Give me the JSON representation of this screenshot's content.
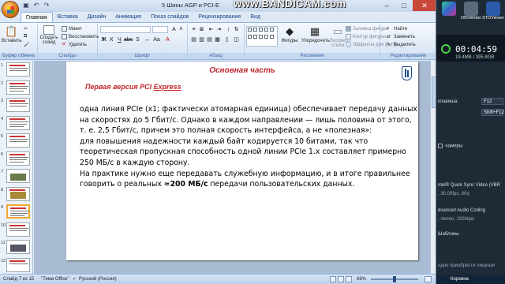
{
  "window": {
    "title": "5 Шины AGP и PCI-E",
    "watermark": "www.BANDICAM.com",
    "minimize": "–",
    "maximize": "□",
    "close": "✕"
  },
  "qat_icons": [
    "save-icon",
    "undo-icon",
    "redo-icon"
  ],
  "tabs": [
    "Главная",
    "Вставка",
    "Дизайн",
    "Анимация",
    "Показ слайдов",
    "Рецензирование",
    "Вид"
  ],
  "ribbon": {
    "clipboard": {
      "label": "Буфер обмена",
      "paste": "Вставить"
    },
    "slides": {
      "label": "Слайды",
      "new_slide": "Создать слайд",
      "layout": "Макет",
      "reset": "Восстановить",
      "delete": "Удалить"
    },
    "font": {
      "label": "Шрифт"
    },
    "paragraph": {
      "label": "Абзац"
    },
    "drawing": {
      "label": "Рисование",
      "shapes": "Фигуры",
      "arrange": "Упорядочить",
      "quick_styles": "Экспресс-стили",
      "fill": "Заливка фигуры",
      "outline": "Контур фигуры",
      "effects": "Эффекты для фигур"
    },
    "editing": {
      "label": "Редактирование",
      "find": "Найти",
      "replace": "Заменить",
      "select": "Выделить"
    }
  },
  "slide_thumbnails": [
    {
      "num": "1"
    },
    {
      "num": "2"
    },
    {
      "num": "3"
    },
    {
      "num": "4"
    },
    {
      "num": "5"
    },
    {
      "num": "6"
    },
    {
      "num": "7"
    },
    {
      "num": "8"
    },
    {
      "num": "9"
    },
    {
      "num": "10"
    },
    {
      "num": "11"
    },
    {
      "num": "12"
    }
  ],
  "slide": {
    "title": "Основная часть",
    "subtitle_plain": "Первая версия PCI ",
    "subtitle_underlined": "Express",
    "lines": [
      "одна линия PCIe (x1; фактически атомарная единица) обеспечивает передачу данных",
      "на скоростях до 5 Гбит/с. Однако в каждом направлении — лишь половина от этого,",
      "т. е. 2,5 Гбит/с, причем это полная скорость интерфейса, а не «полезная»:",
      "для повышения надежности каждый байт кодируется 10 битами, так что",
      "теоретическая пропускная способность одной линии PCIe 1.x составляет примерно",
      "250 МБ/с в каждую сторону.",
      "На практике нужно еще передавать служебную информацию, и в итоге правильнее"
    ],
    "last_line_prefix": "говорить о реальных  ",
    "last_line_bold": "≈200 МБ/с",
    "last_line_suffix": " передачи пользовательских данных."
  },
  "statusbar": {
    "slide_info": "Слайд 7 из 15",
    "theme": "\"Тема Office\"",
    "language": "Русский (Россия)",
    "zoom": "66%"
  },
  "right_panel": {
    "desktop_icons": [
      "",
      "OBSWriter",
      "STDViewer"
    ],
    "rec_time": "00:04:59",
    "rec_size": "19.4MB / 395.8GB",
    "hotkey_label": "клавиша:",
    "hotkey_value": "F12",
    "hotkey2_value": "Shift+F12",
    "camera_label": "-камеры",
    "codec_line": "ntel® Quick Sync Video (VBR",
    "codec_detail": ", 30.00fps, 80q",
    "audio_line": "dvanced Audio Coding",
    "audio_detail": ", stereo, 192kbps",
    "templates": "Шаблоны",
    "promo": "одно приобрести лицензи",
    "taskbar": "Корзина"
  },
  "colors": {
    "accent": "#c0262c",
    "ribbon_blue": "#15428b",
    "logo_blue": "#1d4f8f"
  }
}
